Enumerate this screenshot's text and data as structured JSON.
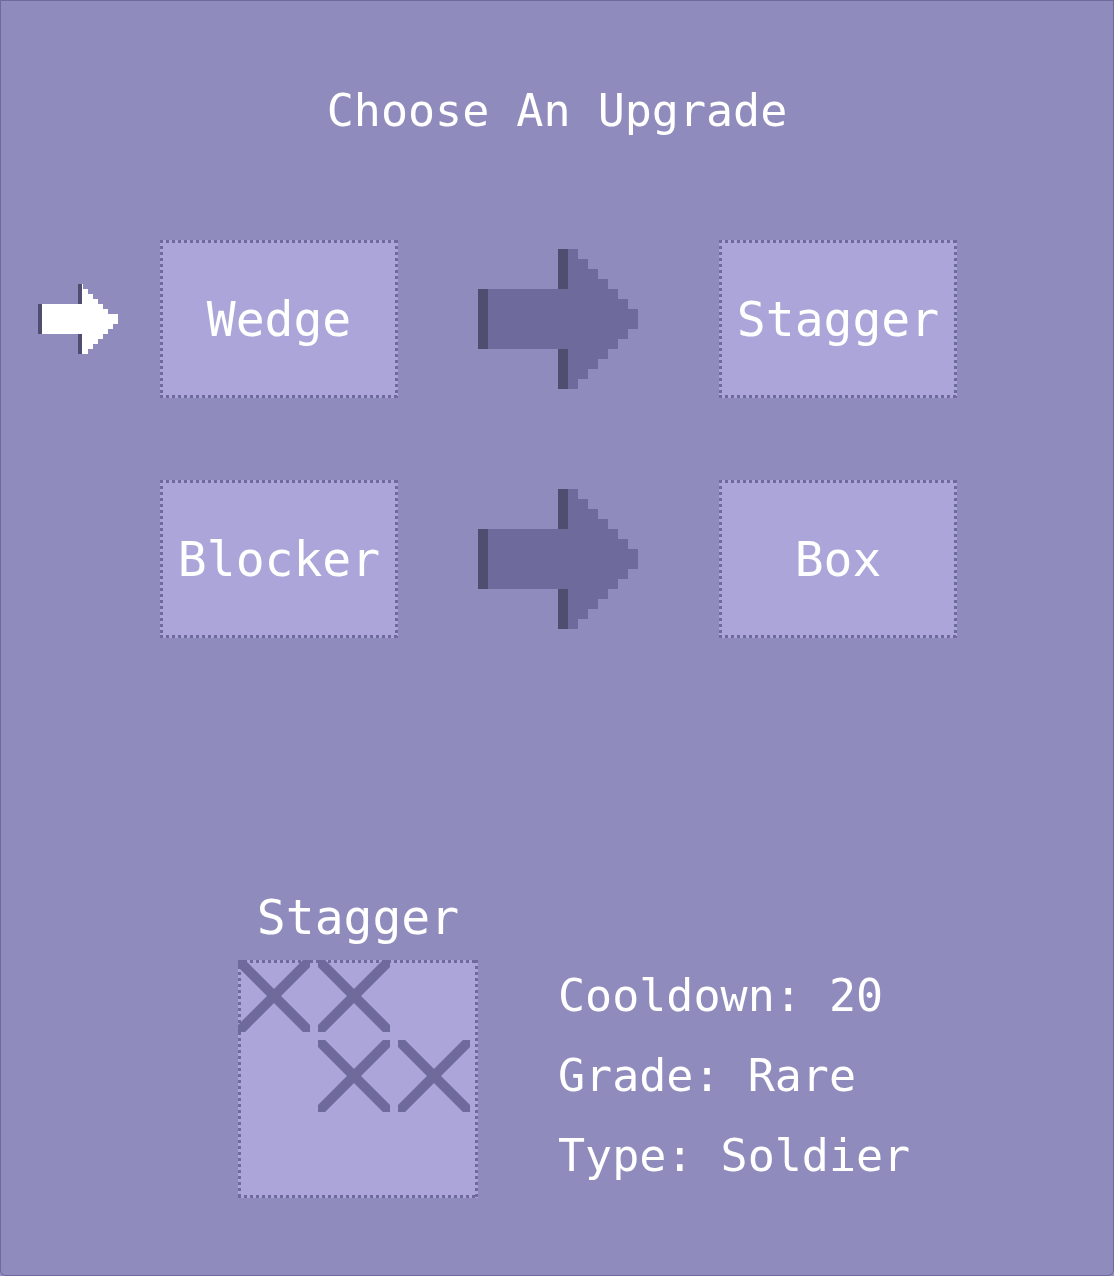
{
  "title": "Choose An Upgrade",
  "upgrades": [
    {
      "from": "Wedge",
      "to": "Stagger",
      "selected": true
    },
    {
      "from": "Blocker",
      "to": "Box",
      "selected": false
    }
  ],
  "preview": {
    "name": "Stagger",
    "pattern": [
      {
        "cells": [
          {
            "marked": true
          },
          {
            "marked": true
          },
          {
            "marked": false
          }
        ]
      },
      {
        "cells": [
          {
            "marked": false
          },
          {
            "marked": true
          },
          {
            "marked": true
          }
        ]
      },
      {
        "cells": [
          {
            "marked": false
          },
          {
            "marked": false
          },
          {
            "marked": false
          }
        ]
      }
    ],
    "stats": [
      "Cooldown: 20",
      "Grade: Rare",
      "Type: Soldier"
    ]
  }
}
